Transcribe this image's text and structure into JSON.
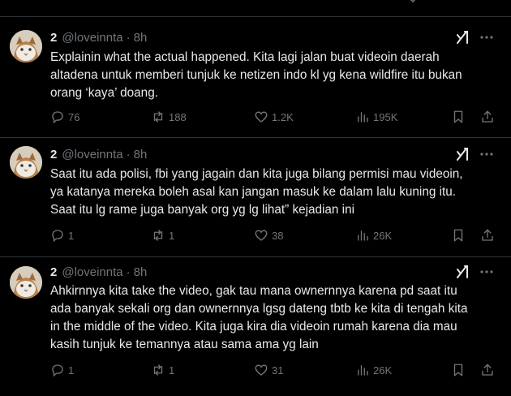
{
  "tweets": [
    {
      "name": "2",
      "handle": "@loveinnta",
      "time": "8h",
      "lines": [
        "Explainin what the actual happened. Kita lagi jalan buat videoin daerah",
        "altadena untuk memberi tunjuk ke netizen indo kl yg kena wildfire itu bukan",
        "orang ‘kaya’ doang."
      ],
      "replies": "76",
      "reposts": "188",
      "likes": "1.2K",
      "views": "195K"
    },
    {
      "name": "2",
      "handle": "@loveinnta",
      "time": "8h",
      "lines": [
        "Saat itu ada polisi, fbi yang jagain dan kita juga bilang permisi mau videoin,",
        "ya katanya mereka boleh asal kan jangan masuk ke dalam lalu kuning itu.",
        "Saat itu lg rame juga banyak org yg lg lihat” kejadian ini"
      ],
      "replies": "1",
      "reposts": "1",
      "likes": "38",
      "views": "26K"
    },
    {
      "name": "2",
      "handle": "@loveinnta",
      "time": "8h",
      "lines": [
        "Ahkirnnya kita take the video, gak tau mana ownernnya karena pd saat itu",
        "ada banyak sekali org dan ownernnya lgsg dateng tbtb ke kita di tengah kita",
        "in the middle of the video. Kita juga kira dia videoin rumah karena dia mau",
        "kasih tunjuk ke temannya atau sama ama yg lain"
      ],
      "replies": "1",
      "reposts": "1",
      "likes": "31",
      "views": "26K"
    }
  ],
  "icons": {
    "reply": "reply-icon",
    "repost": "repost-icon",
    "like": "heart-icon",
    "views": "views-icon",
    "bookmark": "bookmark-icon",
    "share": "share-icon",
    "grok": "grok-icon",
    "more": "more-icon"
  }
}
